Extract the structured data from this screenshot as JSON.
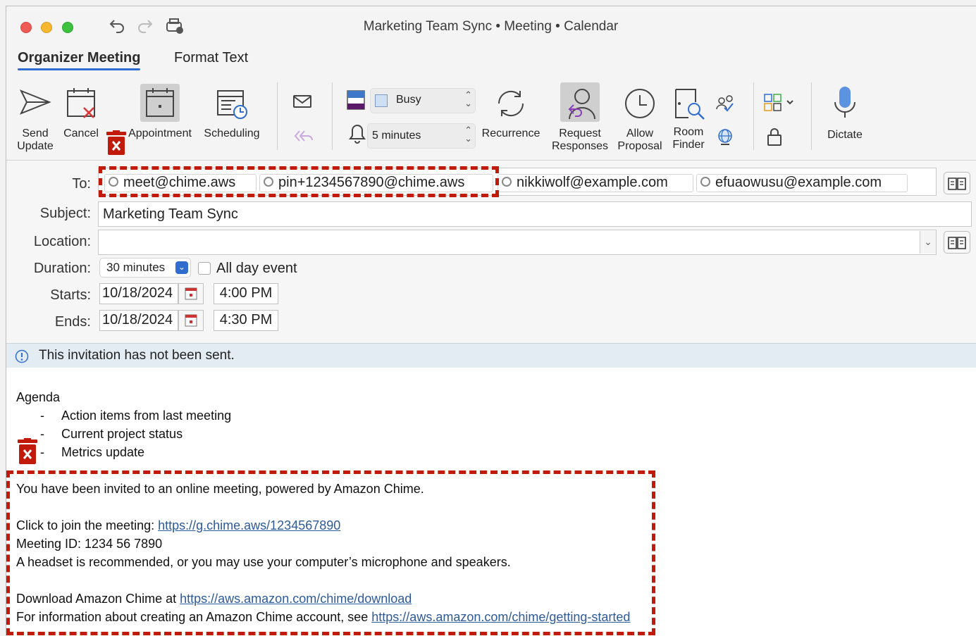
{
  "window": {
    "title": "Marketing Team Sync • Meeting • Calendar"
  },
  "tabs": [
    {
      "label": "Organizer Meeting",
      "active": true
    },
    {
      "label": "Format Text",
      "active": false
    }
  ],
  "ribbon": {
    "send_update": [
      "Send",
      "Update"
    ],
    "cancel": "Cancel",
    "appointment": "Appointment",
    "scheduling": "Scheduling",
    "show_as": "Busy",
    "reminder": "5 minutes",
    "recurrence": "Recurrence",
    "request_responses": [
      "Request",
      "Responses"
    ],
    "allow_proposal": [
      "Allow",
      "Proposal"
    ],
    "room_finder": [
      "Room",
      "Finder"
    ],
    "dictate": "Dictate"
  },
  "form": {
    "to_label": "To:",
    "recipients": [
      "meet@chime.aws",
      "pin+1234567890@chime.aws",
      "nikkiwolf@example.com",
      "efuaowusu@example.com"
    ],
    "subject_label": "Subject:",
    "subject": "Marketing Team Sync",
    "location_label": "Location:",
    "location": "",
    "duration_label": "Duration:",
    "duration": "30 minutes",
    "all_day_label": "All day event",
    "all_day_checked": false,
    "starts_label": "Starts:",
    "start_date": "10/18/2024",
    "start_time": "4:00 PM",
    "ends_label": "Ends:",
    "end_date": "10/18/2024",
    "end_time": "4:30 PM"
  },
  "info": {
    "message": "This invitation has not been sent."
  },
  "body": {
    "agenda_title": "Agenda",
    "bullet": "-",
    "agenda_items": [
      "Action items from last meeting",
      "Current project status",
      "Metrics update"
    ],
    "invite_line": "You have been invited to an online meeting, powered by Amazon Chime.",
    "join_prefix": "Click to join the meeting: ",
    "join_url": "https://g.chime.aws/1234567890",
    "meeting_id": "Meeting ID: 1234 56 7890",
    "headset_line": "A headset is recommended, or you may use your computer’s microphone and speakers.",
    "download_prefix": "Download Amazon Chime at ",
    "download_url": "https://aws.amazon.com/chime/download",
    "info_prefix": "For information about creating an Amazon Chime account, see ",
    "info_url": "https://aws.amazon.com/chime/getting-started"
  },
  "colors": {
    "accent": "#2f6ecf",
    "callout": "#c1190a",
    "link": "#2d5a98",
    "info_bar": "#e3ebf3"
  }
}
